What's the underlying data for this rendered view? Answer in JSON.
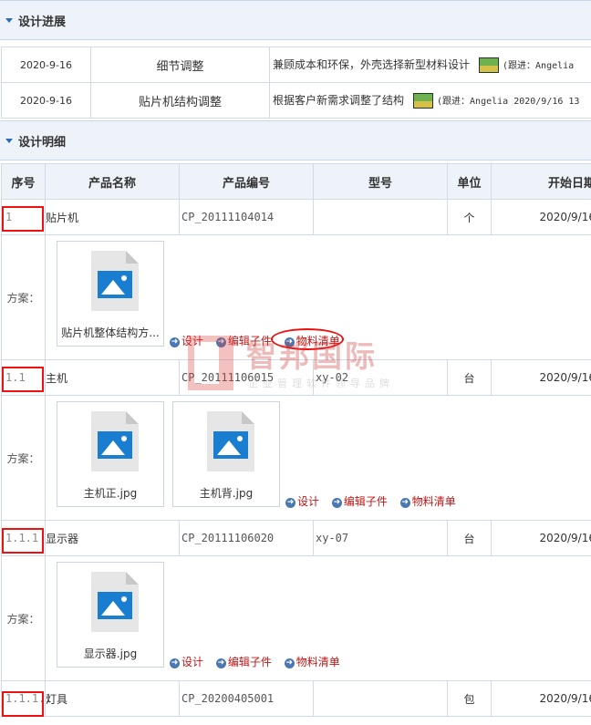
{
  "progress_section": {
    "title": "设计进展"
  },
  "progress_rows": [
    {
      "date": "2020-9-16",
      "stage": "细节调整",
      "content": "兼顾成本和环保，外壳选择新型材料设计",
      "follow": "(跟进：Angelia"
    },
    {
      "date": "2020-9-16",
      "stage": "贴片机结构调整",
      "content": "根据客户新需求调整了结构",
      "follow": "(跟进：Angelia  2020/9/16 13"
    }
  ],
  "detail_section": {
    "title": "设计明细"
  },
  "columns": [
    "序号",
    "产品名称",
    "产品编号",
    "型号",
    "单位",
    "开始日期"
  ],
  "plan_label": "方案：",
  "actions": {
    "design": "设计",
    "edit_sub": "编辑子件",
    "bom": "物料清单"
  },
  "items": [
    {
      "seq": "1",
      "name": "贴片机",
      "code": "CP_20111104014",
      "model": "",
      "unit": "个",
      "start": "2020/9/16",
      "files": [
        "贴片机整体结构方..."
      ]
    },
    {
      "seq": "1.1",
      "name": "主机",
      "code": "CP_20111106015",
      "model": "xy-02",
      "unit": "台",
      "start": "2020/9/16",
      "files": [
        "主机正.jpg",
        "主机背.jpg"
      ]
    },
    {
      "seq": "1.1.1",
      "name": "显示器",
      "code": "CP_20111106020",
      "model": "xy-07",
      "unit": "台",
      "start": "2020/9/16",
      "files": [
        "显示器.jpg"
      ]
    },
    {
      "seq": "1.1.1.1",
      "name": "灯具",
      "code": "CP_20200405001",
      "model": "",
      "unit": "包",
      "start": "2020/9/16"
    }
  ],
  "watermark": {
    "brand": "智邦国际",
    "tagline": "企业管理软件领导品牌"
  },
  "colors": {
    "header_bg": "#eef3fa",
    "border": "#cfdbe9",
    "action_text": "#c01414",
    "annotation": "#e11111"
  }
}
